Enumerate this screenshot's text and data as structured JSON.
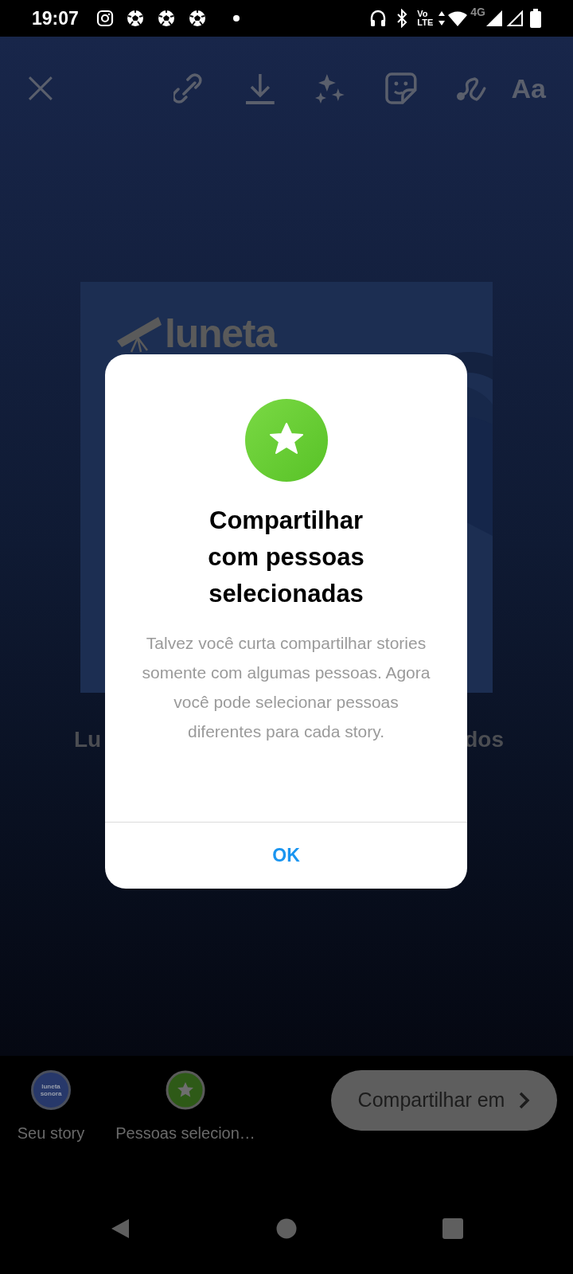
{
  "status_bar": {
    "time": "19:07",
    "volte": [
      "Vo",
      "LTE"
    ],
    "network": "4G"
  },
  "toolbar": {
    "text_tool": "Aa"
  },
  "story_card": {
    "logo_text": "luneta",
    "caption_start": "Lu",
    "caption_end": "dos"
  },
  "dialog": {
    "title": "Compartilhar com pessoas selecionadas",
    "body": "Talvez você curta compartilhar stories somente com algumas pessoas. Agora você pode selecionar pessoas diferentes para cada story.",
    "button": "OK"
  },
  "share_targets": [
    {
      "kind": "avatar",
      "label": "Seu story",
      "avatar_text": [
        "luneta",
        "sonora"
      ]
    },
    {
      "kind": "star",
      "label": "Pessoas selecion…"
    }
  ],
  "share_button": "Compartilhar em"
}
